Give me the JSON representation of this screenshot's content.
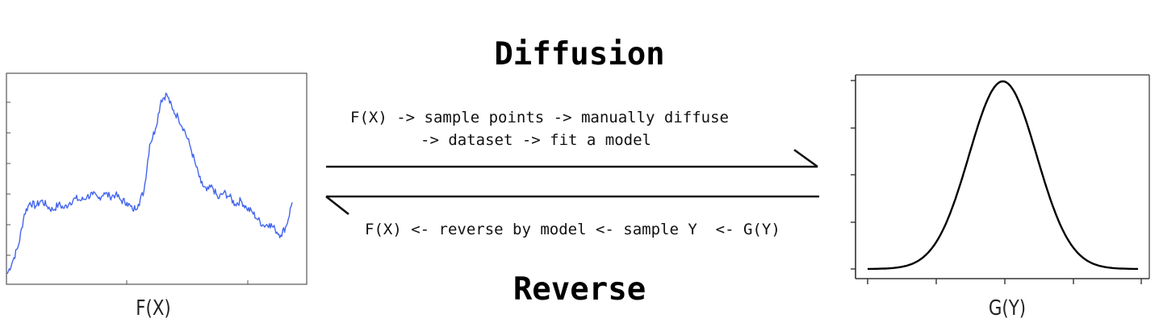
{
  "diagram": {
    "top_title": "Diffusion",
    "bottom_title": "Reverse",
    "forward_process_line1": "F(X) -> sample points -> manually diffuse",
    "forward_process_line2": "-> dataset -> fit a model",
    "reverse_process": "F(X) <- reverse by model <- sample Y  <- G(Y)",
    "left_plot_label": "F(X)",
    "right_plot_label": "G(Y)",
    "left_series_color": "#4466ee",
    "right_series_color": "#000000"
  },
  "chart_data": [
    {
      "type": "line",
      "xlabel": "F(X)",
      "ylabel": "",
      "title": "",
      "grid": false,
      "x": [
        0,
        2,
        4,
        6,
        8,
        10,
        12,
        14,
        16,
        18,
        20,
        22,
        24,
        26,
        28,
        30,
        32,
        34,
        36,
        38,
        40,
        42,
        44,
        46,
        48,
        50,
        52,
        54,
        56,
        58,
        60,
        62,
        64,
        66,
        68,
        70,
        72,
        74,
        76,
        78,
        80,
        82,
        84,
        86,
        88,
        90,
        92,
        94,
        96,
        98,
        100
      ],
      "y": [
        0.05,
        0.12,
        0.2,
        0.36,
        0.42,
        0.4,
        0.43,
        0.4,
        0.38,
        0.41,
        0.39,
        0.42,
        0.44,
        0.43,
        0.45,
        0.46,
        0.44,
        0.47,
        0.45,
        0.46,
        0.43,
        0.42,
        0.38,
        0.41,
        0.48,
        0.72,
        0.8,
        0.95,
        0.98,
        0.9,
        0.86,
        0.8,
        0.72,
        0.62,
        0.52,
        0.48,
        0.5,
        0.44,
        0.47,
        0.45,
        0.41,
        0.43,
        0.39,
        0.37,
        0.33,
        0.3,
        0.31,
        0.28,
        0.25,
        0.3,
        0.42
      ],
      "xlim": [
        0,
        100
      ],
      "ylim": [
        0,
        1.08
      ]
    },
    {
      "type": "line",
      "xlabel": "G(Y)",
      "ylabel": "",
      "title": "",
      "grid": false,
      "x_range": [
        -4,
        4
      ],
      "mean": 0,
      "std": 1,
      "ylim": [
        0,
        1.08
      ]
    }
  ]
}
